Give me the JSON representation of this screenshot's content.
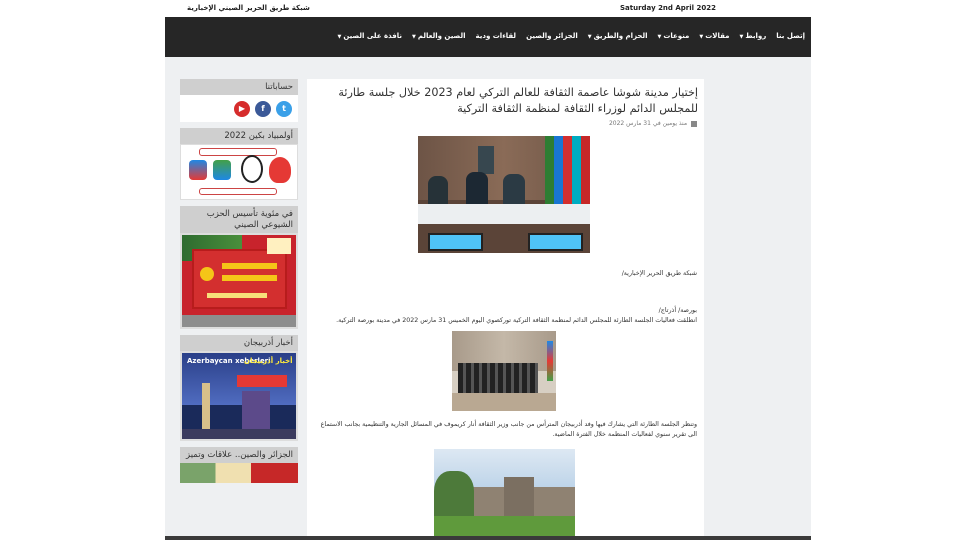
{
  "top": {
    "date": "Saturday 2nd April 2022",
    "site_name": "شبكة طريق الحرير الصيني الإخبارية"
  },
  "nav": {
    "items": [
      {
        "label": "نافذة على الصين",
        "caret": true
      },
      {
        "label": "الصين والعالم",
        "caret": true
      },
      {
        "label": "لقاءات ودية",
        "caret": false
      },
      {
        "label": "الجزائر والصين",
        "caret": false
      },
      {
        "label": "الحزام والطريق",
        "caret": true
      },
      {
        "label": "منوعات",
        "caret": true
      },
      {
        "label": "مقالات",
        "caret": true
      },
      {
        "label": "روابط",
        "caret": true
      },
      {
        "label": "إتصل بنا",
        "caret": false
      }
    ]
  },
  "sidebar": {
    "accounts_title": "حساباتنا",
    "social": [
      {
        "name": "twitter-icon",
        "glyph": "t"
      },
      {
        "name": "facebook-icon",
        "glyph": "f"
      },
      {
        "name": "youtube-icon",
        "glyph": "▶"
      }
    ],
    "olympics_title": "أولمبياد بكين 2022",
    "cpc_title": "في مئوية تأسيس الحزب الشيوعي الصيني",
    "azerbaijan_title": "أخبار أذربيجان",
    "azerbaijan_banner": {
      "line1": "Azerbaycan xeberleri",
      "line2": "أخبار أذربيجان"
    },
    "algeria_title": "الجزائر والصين.. علاقات وتميز"
  },
  "article": {
    "title": "إختيار مدينة شوشا عاصمة الثقافة للعالم التركي لعام 2023 خلال جلسة طارئة للمجلس الدائم لوزراء الثقافة لمنظمة الثقافة التركية",
    "meta": "منذ يومين في 31 مارس 2022",
    "source": "شبكة طريق الحرير الإخبارية/",
    "dateline": "بورصة/ أذرتاج/",
    "para1": "انطلقت فعاليات الجلسة الطارئة للمجلس الدائم لمنظمة الثقافة التركية توركصوي اليوم الخميس 31 مارس 2022 في مدينة بورصة التركية.",
    "para2": "وتنظر الجلسة الطارئة التي يشارك فيها وفد أذربيجان المترأس من جانب وزير الثقافة أنار كريموف في المسائل الجارية والتنظيمية بجانب الاستماع الى تقرير سنوي لفعاليات المنظمة خلال الفترة الماضية."
  }
}
